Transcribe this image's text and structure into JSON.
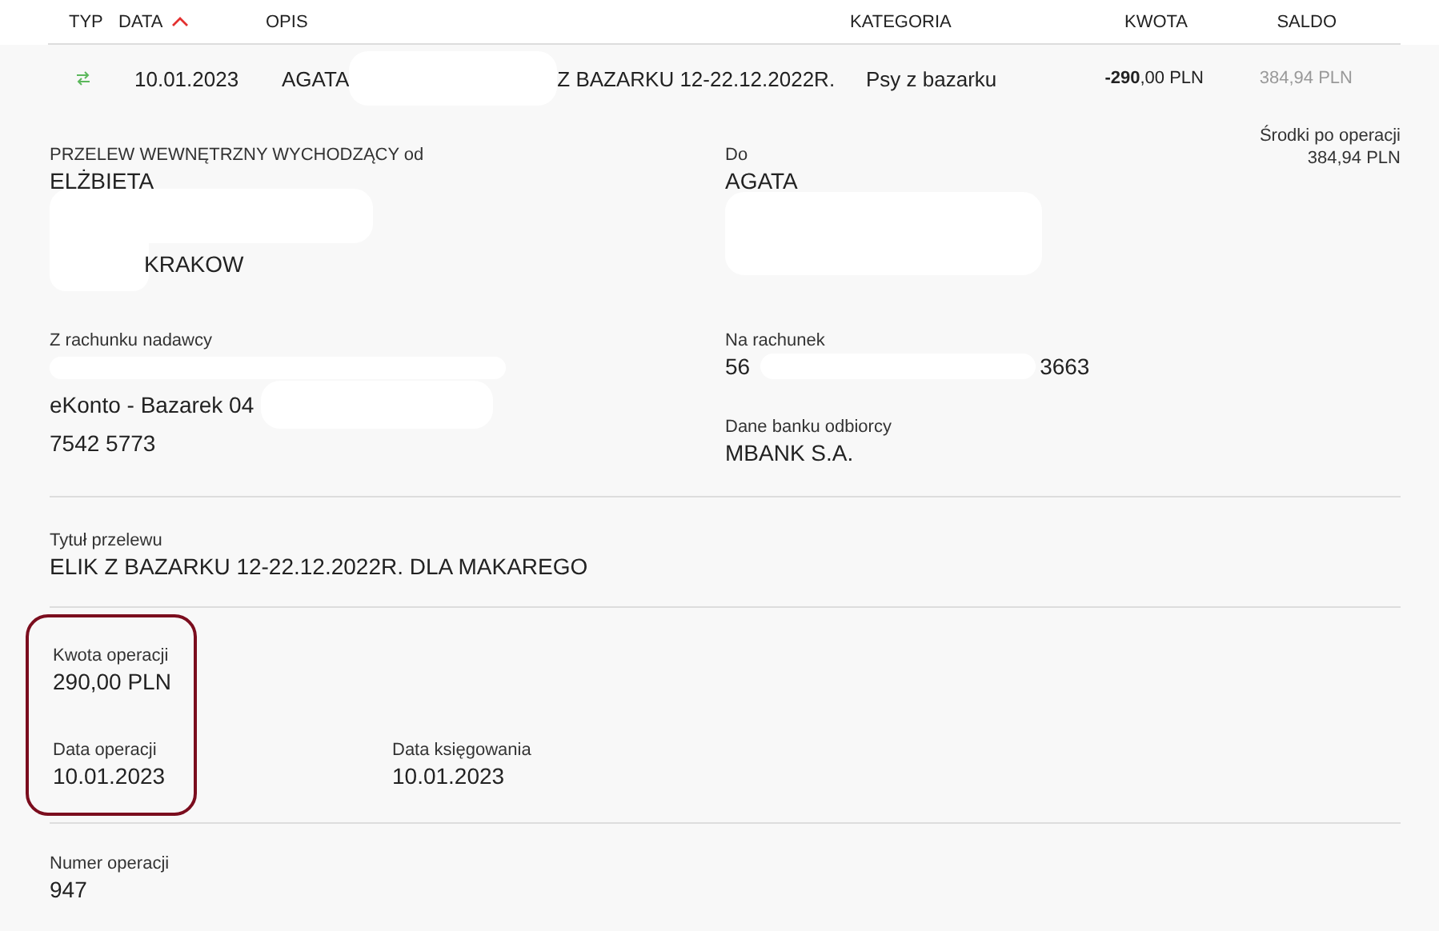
{
  "columns": [
    {
      "label": "TYP",
      "sorted": false
    },
    {
      "label": "DATA",
      "sorted": true
    },
    {
      "label": "OPIS",
      "sorted": false
    },
    {
      "label": "KATEGORIA",
      "sorted": false
    },
    {
      "label": "KWOTA",
      "sorted": false
    },
    {
      "label": "SALDO",
      "sorted": false
    }
  ],
  "row": {
    "date": "10.01.2023",
    "description_start": "AGATA",
    "description_end": "Z BAZARKU 12-22.12.2022R.",
    "category": "Psy z bazarku",
    "amount": "**-290**,00 PLN",
    "balance": "384,94 PLN"
  },
  "sender": {
    "label": "PRZELEW WEWNĘTRZNY WYCHODZĄCY od",
    "name": "ELŻBIETA",
    "city": "KRAKOW"
  },
  "recipient": {
    "label": "Do",
    "name": "AGATA"
  },
  "funds_after": {
    "label": "Środki po operacji",
    "value": "384,94 PLN"
  },
  "from_account": {
    "label": "Z rachunku nadawcy",
    "name": "eKonto - Bazarek 04",
    "number": "7542 5773"
  },
  "to_account": {
    "label": "Na rachunek",
    "start": "56",
    "end": "3663"
  },
  "recipient_bank": {
    "label": "Dane banku odbiorcy",
    "value": "MBANK S.A."
  },
  "title": {
    "label": "Tytuł przelewu",
    "value": "ELIK Z BAZARKU 12-22.12.2022R. DLA MAKAREGO"
  },
  "operation": {
    "highlighted": true,
    "amount_label": "Kwota operacji",
    "amount": "290,00 PLN",
    "date_label": "Data operacji",
    "date": "10.01.2023"
  },
  "booking": {
    "label": "Data księgowania",
    "value": "10.01.2023"
  },
  "number": {
    "label": "Numer operacji",
    "value": "947"
  }
}
